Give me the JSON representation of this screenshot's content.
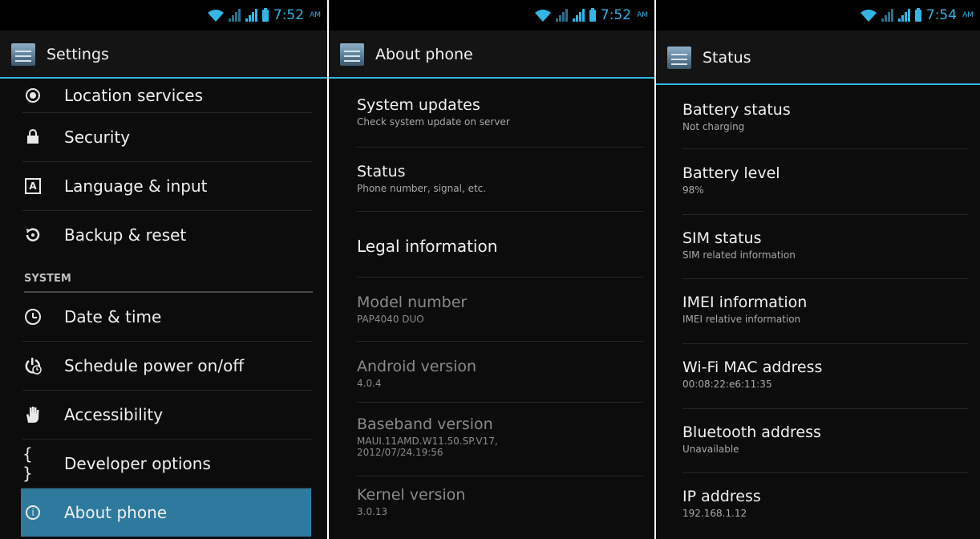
{
  "panel_settings": {
    "time": "7:52",
    "ampm": "AM",
    "title": "Settings",
    "items_top": [
      {
        "label": "Location services",
        "icon": "location-icon"
      },
      {
        "label": "Security",
        "icon": "lock-icon"
      },
      {
        "label": "Language & input",
        "icon": "keyboard-icon"
      },
      {
        "label": "Backup & reset",
        "icon": "backup-icon"
      }
    ],
    "section_header": "SYSTEM",
    "items_system": [
      {
        "label": "Date & time",
        "icon": "clock-icon"
      },
      {
        "label": "Schedule power on/off",
        "icon": "power-schedule-icon"
      },
      {
        "label": "Accessibility",
        "icon": "hand-icon"
      },
      {
        "label": "Developer options",
        "icon": "braces-icon"
      },
      {
        "label": "About phone",
        "icon": "info-icon"
      }
    ]
  },
  "panel_about": {
    "time": "7:52",
    "ampm": "AM",
    "title": "About phone",
    "items": [
      {
        "title": "System updates",
        "subtitle": "Check system update on server"
      },
      {
        "title": "Status",
        "subtitle": "Phone number, signal, etc."
      },
      {
        "title": "Legal information",
        "subtitle": ""
      },
      {
        "title": "Model number",
        "subtitle": "PAP4040 DUO"
      },
      {
        "title": "Android version",
        "subtitle": "4.0.4"
      },
      {
        "title": "Baseband version",
        "subtitle": "MAUI.11AMD.W11.50.SP.V17, 2012/07/24.19:56"
      },
      {
        "title": "Kernel version",
        "subtitle": "3.0.13"
      }
    ]
  },
  "panel_status": {
    "time": "7:54",
    "ampm": "AM",
    "title": "Status",
    "items": [
      {
        "title": "Battery status",
        "subtitle": "Not charging"
      },
      {
        "title": "Battery level",
        "subtitle": "98%"
      },
      {
        "title": "SIM status",
        "subtitle": "SIM related information"
      },
      {
        "title": "IMEI information",
        "subtitle": "IMEI relative information"
      },
      {
        "title": "Wi-Fi MAC address",
        "subtitle": "00:08:22:e6:11:35"
      },
      {
        "title": "Bluetooth address",
        "subtitle": "Unavailable"
      },
      {
        "title": "IP address",
        "subtitle": "192.168.1.12"
      }
    ]
  },
  "colors": {
    "accent": "#33b5e5",
    "selected": "#2d7a9e",
    "background": "#0c0c0c"
  }
}
